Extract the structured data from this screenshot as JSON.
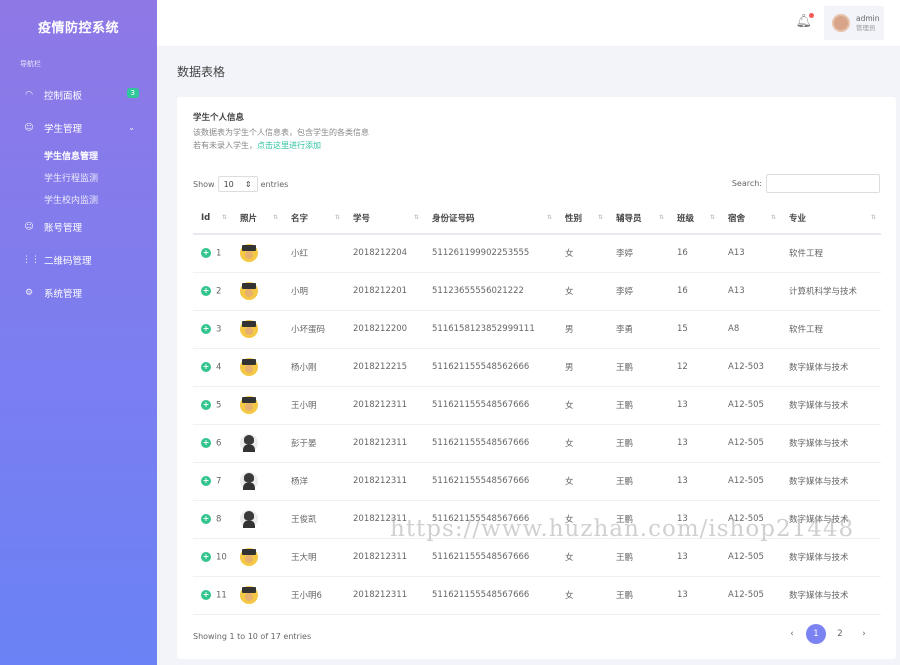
{
  "app": {
    "title": "疫情防控系统"
  },
  "sidebar": {
    "caption": "导航栏",
    "items": [
      {
        "label": "控制面板",
        "icon": "dashboard-icon",
        "badge": "3"
      },
      {
        "label": "学生管理",
        "icon": "users-icon",
        "expanded": true,
        "children": [
          {
            "label": "学生信息管理",
            "active": true
          },
          {
            "label": "学生行程监测"
          },
          {
            "label": "学生校内监测"
          }
        ]
      },
      {
        "label": "账号管理",
        "icon": "users-icon"
      },
      {
        "label": "二维码管理",
        "icon": "grid-icon"
      },
      {
        "label": "系统管理",
        "icon": "gear-icon"
      }
    ]
  },
  "topbar": {
    "user_name": "admin",
    "user_role": "管理员"
  },
  "page": {
    "title": "数据表格"
  },
  "card": {
    "title": "学生个人信息",
    "desc_line1": "该数据表为学生个人信息表，包含学生的各类信息",
    "desc_line2_prefix": "若有未录入学生，",
    "desc_line2_link": "点击这里进行添加"
  },
  "table_controls": {
    "show_label": "Show",
    "entries_value": "10",
    "entries_label": "entries",
    "search_label": "Search:"
  },
  "table": {
    "headers": [
      "Id",
      "照片",
      "名字",
      "学号",
      "身份证号码",
      "性别",
      "辅导员",
      "班级",
      "宿舍",
      "专业"
    ],
    "rows": [
      {
        "id": "1",
        "photo": "grad",
        "name": "小红",
        "student_no": "2018212204",
        "id_card": "511261199902253555",
        "gender": "女",
        "counselor": "李婷",
        "class": "16",
        "dorm": "A13",
        "major": "软件工程"
      },
      {
        "id": "2",
        "photo": "grad",
        "name": "小明",
        "student_no": "2018212201",
        "id_card": "51123655556021222",
        "gender": "女",
        "counselor": "李婷",
        "class": "16",
        "dorm": "A13",
        "major": "计算机科学与技术"
      },
      {
        "id": "3",
        "photo": "grad",
        "name": "小坏蛋码",
        "student_no": "2018212200",
        "id_card": "5116158123852999111",
        "gender": "男",
        "counselor": "李勇",
        "class": "15",
        "dorm": "A8",
        "major": "软件工程"
      },
      {
        "id": "4",
        "photo": "grad",
        "name": "杨小刚",
        "student_no": "2018212215",
        "id_card": "511621155548562666",
        "gender": "男",
        "counselor": "王鹏",
        "class": "12",
        "dorm": "A12-503",
        "major": "数字媒体与技术"
      },
      {
        "id": "5",
        "photo": "grad",
        "name": "王小明",
        "student_no": "2018212311",
        "id_card": "511621155548567666",
        "gender": "女",
        "counselor": "王鹏",
        "class": "13",
        "dorm": "A12-505",
        "major": "数字媒体与技术"
      },
      {
        "id": "6",
        "photo": "man",
        "name": "彭于晏",
        "student_no": "2018212311",
        "id_card": "511621155548567666",
        "gender": "女",
        "counselor": "王鹏",
        "class": "13",
        "dorm": "A12-505",
        "major": "数字媒体与技术"
      },
      {
        "id": "7",
        "photo": "man",
        "name": "杨洋",
        "student_no": "2018212311",
        "id_card": "511621155548567666",
        "gender": "女",
        "counselor": "王鹏",
        "class": "13",
        "dorm": "A12-505",
        "major": "数字媒体与技术"
      },
      {
        "id": "8",
        "photo": "man",
        "name": "王俊凯",
        "student_no": "2018212311",
        "id_card": "511621155548567666",
        "gender": "女",
        "counselor": "王鹏",
        "class": "13",
        "dorm": "A12-505",
        "major": "数字媒体与技术"
      },
      {
        "id": "10",
        "photo": "grad",
        "name": "王大明",
        "student_no": "2018212311",
        "id_card": "511621155548567666",
        "gender": "女",
        "counselor": "王鹏",
        "class": "13",
        "dorm": "A12-505",
        "major": "数字媒体与技术"
      },
      {
        "id": "11",
        "photo": "grad",
        "name": "王小明6",
        "student_no": "2018212311",
        "id_card": "511621155548567666",
        "gender": "女",
        "counselor": "王鹏",
        "class": "13",
        "dorm": "A12-505",
        "major": "数字媒体与技术"
      }
    ]
  },
  "footer": {
    "info": "Showing 1 to 10 of 17 entries",
    "pages": [
      "1",
      "2"
    ],
    "current_page": "1",
    "prev": "‹",
    "next": "›"
  },
  "watermark": "https://www.huzhan.com/ishop21448",
  "colors": {
    "sidebar_top": "#8f78e6",
    "sidebar_bottom": "#6a82f5",
    "accent": "#7b82f2",
    "badge": "#30c79b",
    "link": "#2dc3a1"
  }
}
